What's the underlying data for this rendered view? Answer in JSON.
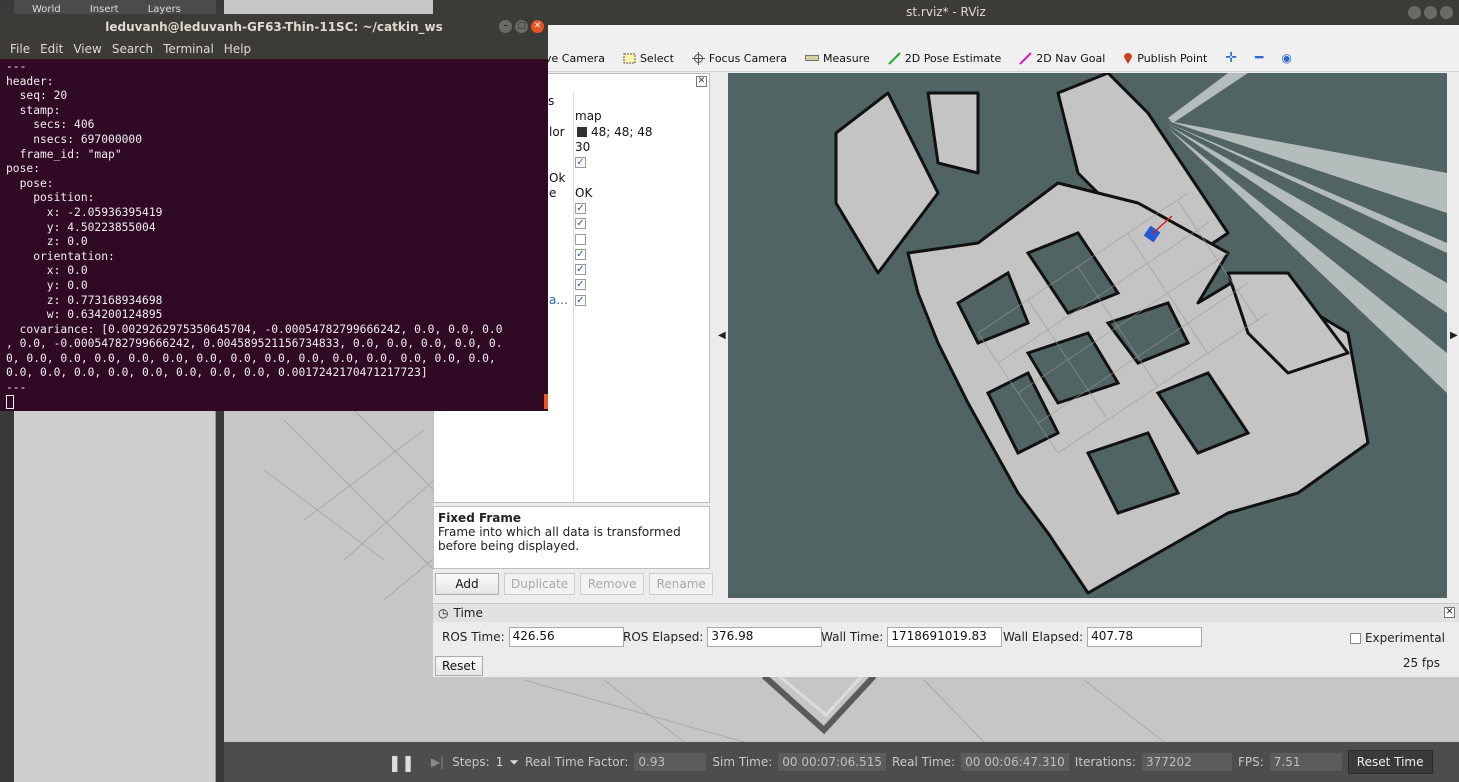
{
  "gazebo": {
    "tabs": [
      "World",
      "Insert",
      "Layers"
    ],
    "bottom": {
      "steps_label": "Steps:",
      "steps_value": "1",
      "rtf_label": "Real Time Factor:",
      "rtf_value": "0.93",
      "sim_time_label": "Sim Time:",
      "sim_time_value": "00 00:07:06.515",
      "real_time_label": "Real Time:",
      "real_time_value": "00 00:06:47.310",
      "iterations_label": "Iterations:",
      "iterations_value": "377202",
      "fps_label": "FPS:",
      "fps_value": "7.51",
      "reset_time_label": "Reset Time"
    }
  },
  "rviz": {
    "title": "st.rviz* - RViz",
    "toolbar": {
      "move_camera": "ve Camera",
      "select": "Select",
      "focus_camera": "Focus Camera",
      "measure": "Measure",
      "pose_estimate": "2D Pose Estimate",
      "nav_goal": "2D Nav Goal",
      "publish_point": "Publish Point"
    },
    "displays": {
      "partial_label_1": "s",
      "partial_label_2": "lor",
      "partial_label_3": "Ok",
      "partial_label_4": "e",
      "partial_label_5": "a...",
      "fixed_frame_value": "map",
      "background_color_value": "48; 48; 48",
      "frame_rate_value": "30",
      "status_value": "OK"
    },
    "help": {
      "title": "Fixed Frame",
      "text": "Frame into which all data is transformed before being displayed."
    },
    "buttons": {
      "add": "Add",
      "duplicate": "Duplicate",
      "remove": "Remove",
      "rename": "Rename"
    },
    "time": {
      "title": "Time",
      "ros_time_label": "ROS Time:",
      "ros_time_value": "426.56",
      "ros_elapsed_label": "ROS Elapsed:",
      "ros_elapsed_value": "376.98",
      "wall_time_label": "Wall Time:",
      "wall_time_value": "1718691019.83",
      "wall_elapsed_label": "Wall Elapsed:",
      "wall_elapsed_value": "407.78",
      "experimental_label": "Experimental",
      "reset_label": "Reset",
      "fps": "25 fps"
    }
  },
  "terminal": {
    "title": "leduvanh@leduvanh-GF63-Thin-11SC: ~/catkin_ws",
    "menu": [
      "File",
      "Edit",
      "View",
      "Search",
      "Terminal",
      "Help"
    ],
    "lines": [
      "---",
      "header:",
      "  seq: 20",
      "  stamp:",
      "    secs: 406",
      "    nsecs: 697000000",
      "  frame_id: \"map\"",
      "pose:",
      "  pose:",
      "    position:",
      "      x: -2.05936395419",
      "      y: 4.50223855004",
      "      z: 0.0",
      "    orientation:",
      "      x: 0.0",
      "      y: 0.0",
      "      z: 0.773168934698",
      "      w: 0.634200124895",
      "  covariance: [0.0029262975350645704, -0.00054782799666242, 0.0, 0.0, 0.0",
      ", 0.0, -0.00054782799666242, 0.004589521156734833, 0.0, 0.0, 0.0, 0.0, 0.",
      "0, 0.0, 0.0, 0.0, 0.0, 0.0, 0.0, 0.0, 0.0, 0.0, 0.0, 0.0, 0.0, 0.0, 0.0,",
      "0.0, 0.0, 0.0, 0.0, 0.0, 0.0, 0.0, 0.0, 0.0017242170471217723]",
      "---"
    ]
  }
}
